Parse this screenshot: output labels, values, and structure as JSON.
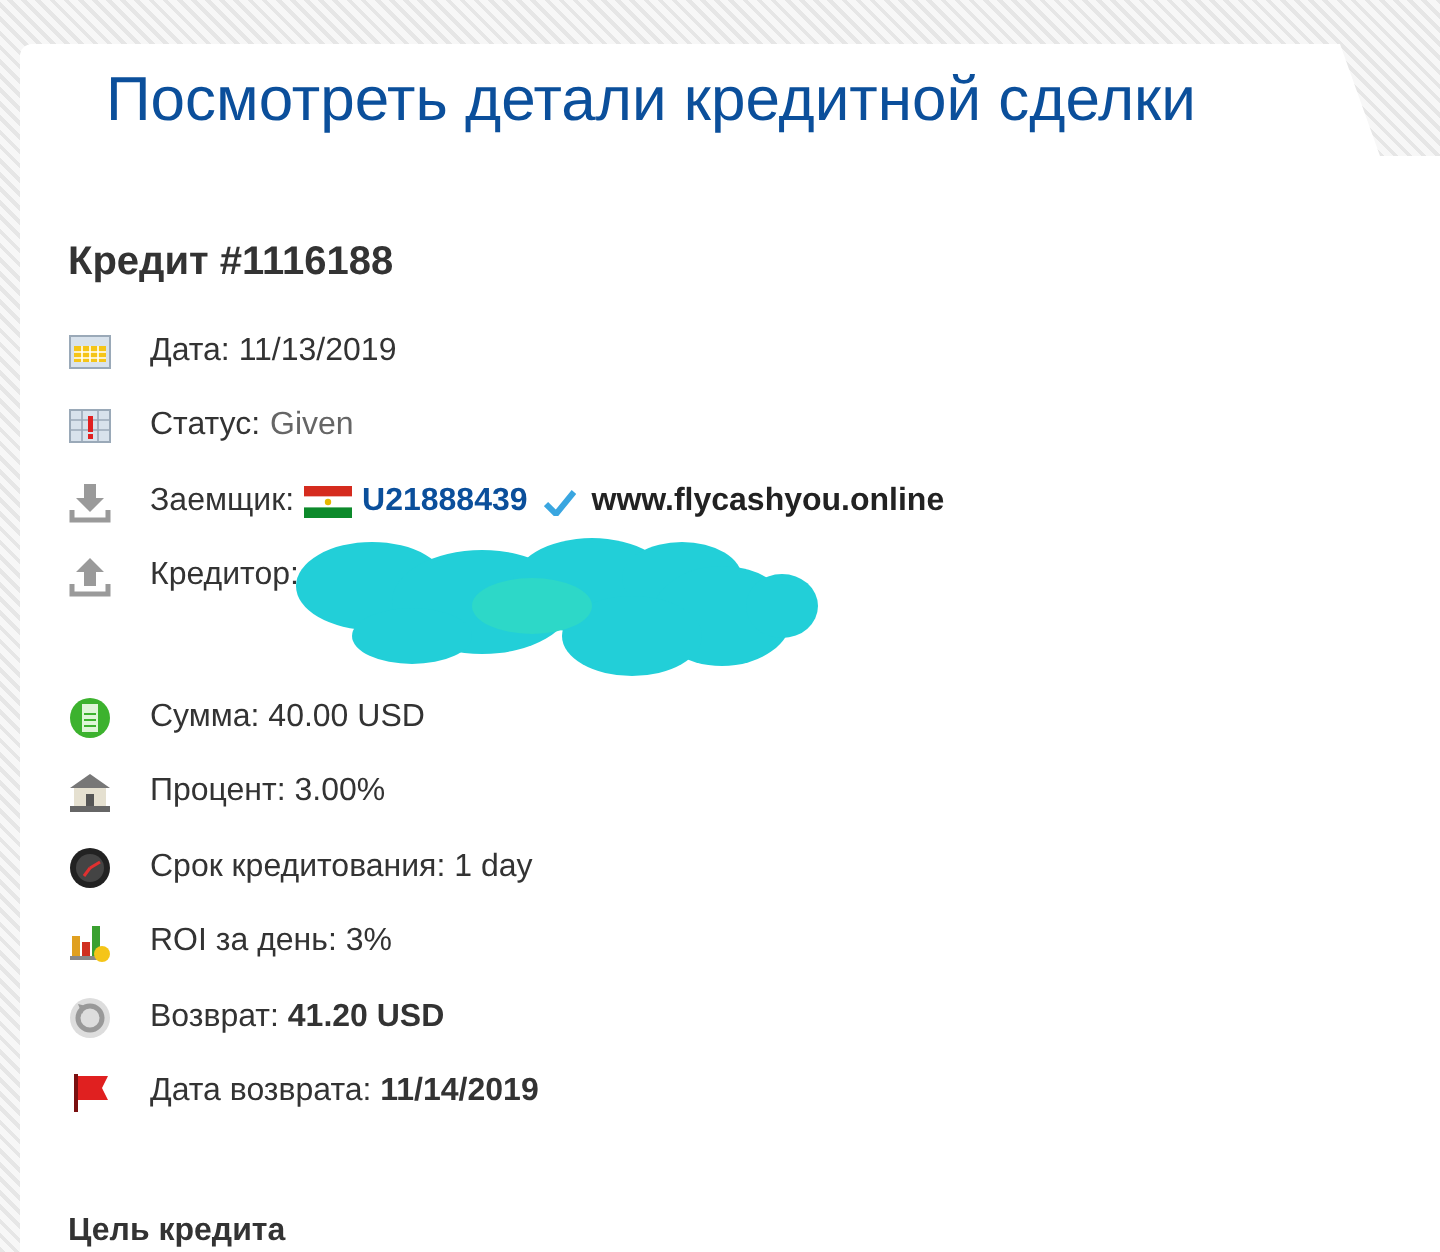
{
  "page_title": "Посмотреть детали кредитной сделки",
  "loan": {
    "heading": "Кредит #1116188",
    "rows": [
      {
        "kind": "plain",
        "text": "Дата: 11/13/2019"
      },
      {
        "kind": "status",
        "label": "Статус:",
        "value": "Given"
      },
      {
        "kind": "borrower",
        "label": "Заемщик:",
        "user_id": "U21888439",
        "verified": true,
        "site": "www.flycashyou.online"
      },
      {
        "kind": "redacted",
        "label": "Кредитор:"
      },
      {
        "kind": "plain",
        "text": "Сумма: 40.00 USD"
      },
      {
        "kind": "plain",
        "text": "Процент: 3.00%"
      },
      {
        "kind": "plain",
        "text": "Срок кредитования: 1 day"
      },
      {
        "kind": "plain",
        "text": "ROI за день: 3%"
      },
      {
        "kind": "plain",
        "text": "Возврат: **41.20 USD**"
      },
      {
        "kind": "plain",
        "text": "Дата возврата: **11/14/2019**"
      }
    ]
  },
  "purpose_heading": "Цель кредита"
}
